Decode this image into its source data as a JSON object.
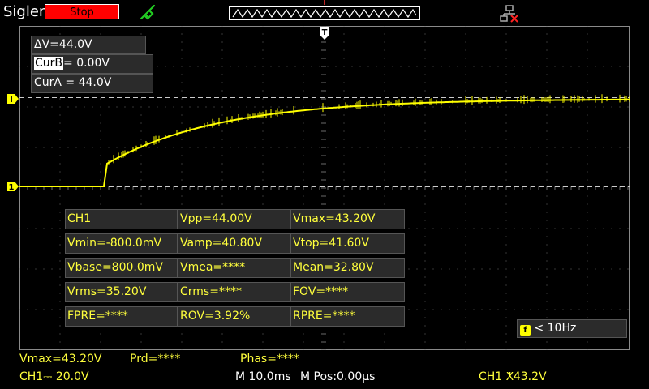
{
  "topbar": {
    "brand": "Siglent",
    "run_state": "Stop"
  },
  "cursor_panel": {
    "delta": "ΔV=44.0V",
    "curb_label": "CurB",
    "curb_value": "= 0.00V",
    "cura": "CurA = 44.0V"
  },
  "markers": {
    "channel_level": "1",
    "cursor_level": "I",
    "trigger": "T"
  },
  "measurements": {
    "rows": [
      [
        "CH1",
        "Vpp=44.00V",
        "Vmax=43.20V"
      ],
      [
        "Vmin=-800.0mV",
        "Vamp=40.80V",
        "Vtop=41.60V"
      ],
      [
        "Vbase=800.0mV",
        "Vmea=****",
        "Mean=32.80V"
      ],
      [
        "Vrms=35.20V",
        "Crms=****",
        "FOV=****"
      ],
      [
        "FPRE=****",
        "ROV=3.92%",
        "RPRE=****"
      ]
    ]
  },
  "trigger_freq": {
    "badge": "f",
    "value": "< 10Hz"
  },
  "status": {
    "vmax": "Vmax=43.20V",
    "prd": "Prd=****",
    "phas": "Phas=****",
    "ch1_scale": "CH1⎓ 20.0V",
    "timebase": "M 10.0ms",
    "mpos": "M Pos:0.00µs",
    "trig": "CH1 ⵅ43.2V"
  },
  "waveform": {
    "color": "#ffff00",
    "baseline_v": 0.0,
    "final_v": 43.2,
    "rise_start_ms": 14.0
  }
}
